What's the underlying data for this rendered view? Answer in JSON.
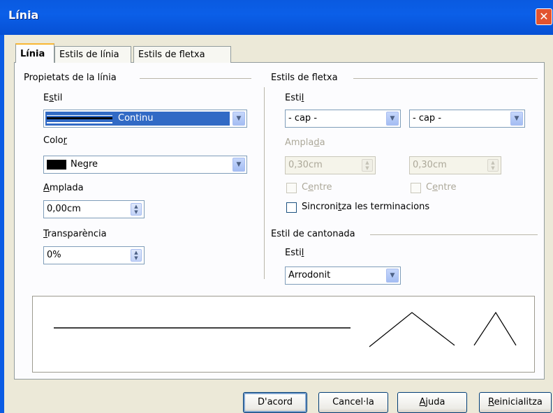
{
  "window": {
    "title": "Línia",
    "close_symbol": "✕"
  },
  "tabs": [
    "Línia",
    "Estils de línia",
    "Estils de fletxa"
  ],
  "line_properties": {
    "section_title": "Propietats de la línia",
    "style": {
      "label_pre": "E",
      "label_accel": "s",
      "label_post": "til",
      "value": "Continu"
    },
    "color": {
      "label_pre": "Colo",
      "label_accel": "r",
      "label_post": "",
      "value": "Negre",
      "swatch": "#000000"
    },
    "width": {
      "label_pre": "",
      "label_accel": "A",
      "label_post": "mplada",
      "value": "0,00cm"
    },
    "transparency": {
      "label_pre": "",
      "label_accel": "T",
      "label_post": "ransparència",
      "value": "0%"
    }
  },
  "arrow_styles": {
    "section_title": "Estils de fletxa",
    "style_label_pre": "Esti",
    "style_label_accel": "l",
    "style_label_post": "",
    "start_value": "- cap -",
    "end_value": "- cap -",
    "width_label_pre": "Ampla",
    "width_label_accel": "d",
    "width_label_post": "a",
    "start_width": "0,30cm",
    "end_width": "0,30cm",
    "center_pre": "C",
    "center_accel": "e",
    "center_post": "ntre",
    "sync_pre": "Sincroni",
    "sync_accel": "t",
    "sync_post": "za les terminacions"
  },
  "corner_style": {
    "section_title": "Estil de cantonada",
    "label_pre": "Esti",
    "label_accel": "l",
    "label_post": "",
    "value": "Arrodonit"
  },
  "buttons": {
    "ok": "D'acord",
    "cancel": "Cancel·la",
    "help_accel": "A",
    "help_post": "juda",
    "reset_accel": "R",
    "reset_post": "einicialitza"
  },
  "colors": {
    "titlebar": "#0b5fe8",
    "dialog_bg": "#ece9d8",
    "selection": "#316ac5"
  }
}
